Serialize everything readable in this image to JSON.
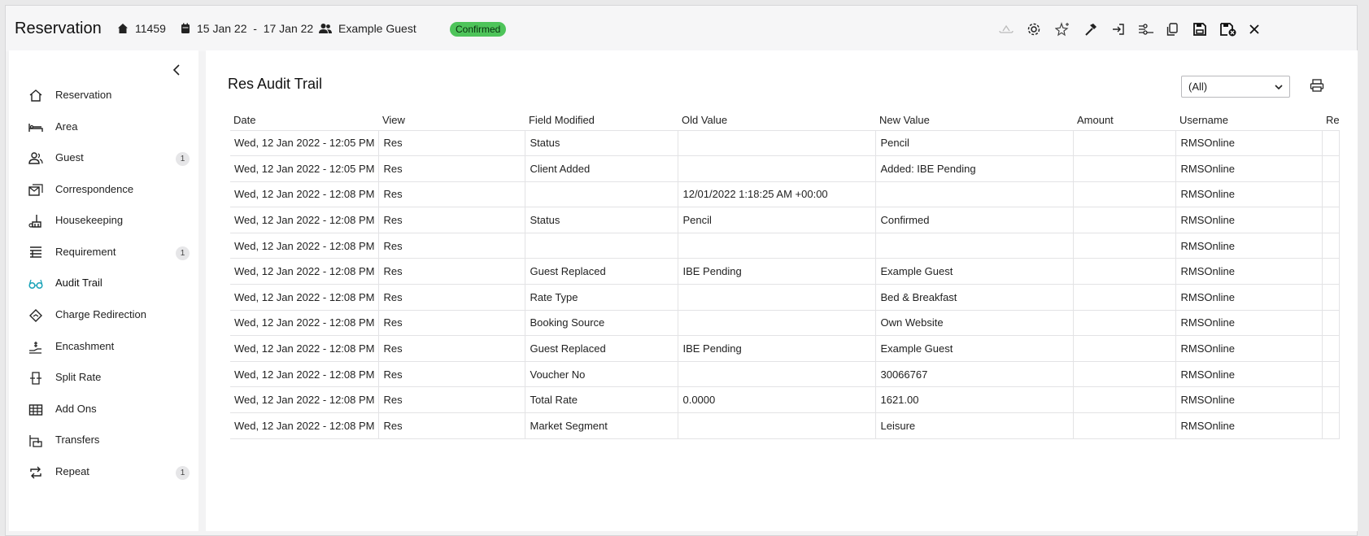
{
  "header": {
    "title": "Reservation",
    "property_id": "11459",
    "dates": "15 Jan 22  -  17 Jan 22",
    "guest": "Example Guest",
    "status": "Confirmed",
    "status_color": "#4ec45a"
  },
  "sidebar": {
    "items": [
      {
        "label": "Reservation",
        "icon": "home-icon"
      },
      {
        "label": "Area",
        "icon": "bed-icon"
      },
      {
        "label": "Guest",
        "icon": "users-icon",
        "count": "1"
      },
      {
        "label": "Correspondence",
        "icon": "mail-icon"
      },
      {
        "label": "Housekeeping",
        "icon": "housekeeping-icon"
      },
      {
        "label": "Requirement",
        "icon": "list-icon",
        "count": "1"
      },
      {
        "label": "Audit Trail",
        "icon": "glasses-icon"
      },
      {
        "label": "Charge Redirection",
        "icon": "redirect-icon"
      },
      {
        "label": "Encashment",
        "icon": "encash-icon"
      },
      {
        "label": "Split Rate",
        "icon": "split-icon"
      },
      {
        "label": "Add Ons",
        "icon": "grid-icon"
      },
      {
        "label": "Transfers",
        "icon": "transfer-icon"
      },
      {
        "label": "Repeat",
        "icon": "repeat-icon",
        "count": "1"
      }
    ],
    "active": "Audit Trail",
    "accent_color": "#1aa3b8"
  },
  "main": {
    "title": "Res Audit Trail",
    "filter": "(All)",
    "columns": [
      "Date",
      "View",
      "Field Modified",
      "Old Value",
      "New Value",
      "Amount",
      "Username",
      "Re"
    ],
    "rows": [
      [
        "Wed, 12 Jan 2022 - 12:05 PM",
        "Res",
        "Status",
        "",
        "Pencil",
        "",
        "RMSOnline",
        ""
      ],
      [
        "Wed, 12 Jan 2022 - 12:05 PM",
        "Res",
        "Client Added",
        "",
        "Added: IBE Pending",
        "",
        "RMSOnline",
        ""
      ],
      [
        "Wed, 12 Jan 2022 - 12:08 PM",
        "Res",
        "",
        "12/01/2022 1:18:25 AM +00:00",
        "",
        "",
        "RMSOnline",
        ""
      ],
      [
        "Wed, 12 Jan 2022 - 12:08 PM",
        "Res",
        "Status",
        "Pencil",
        "Confirmed",
        "",
        "RMSOnline",
        ""
      ],
      [
        "Wed, 12 Jan 2022 - 12:08 PM",
        "Res",
        "",
        "",
        "",
        "",
        "RMSOnline",
        ""
      ],
      [
        "Wed, 12 Jan 2022 - 12:08 PM",
        "Res",
        "Guest Replaced",
        "IBE Pending",
        "Example Guest",
        "",
        "RMSOnline",
        ""
      ],
      [
        "Wed, 12 Jan 2022 - 12:08 PM",
        "Res",
        "Rate Type",
        "",
        "Bed & Breakfast",
        "",
        "RMSOnline",
        ""
      ],
      [
        "Wed, 12 Jan 2022 - 12:08 PM",
        "Res",
        "Booking Source",
        "",
        "Own Website",
        "",
        "RMSOnline",
        ""
      ],
      [
        "Wed, 12 Jan 2022 - 12:08 PM",
        "Res",
        "Guest Replaced",
        "IBE Pending",
        "Example Guest",
        "",
        "RMSOnline",
        ""
      ],
      [
        "Wed, 12 Jan 2022 - 12:08 PM",
        "Res",
        "Voucher No",
        "",
        "30066767",
        "",
        "RMSOnline",
        ""
      ],
      [
        "Wed, 12 Jan 2022 - 12:08 PM",
        "Res",
        "Total Rate",
        "0.0000",
        "1621.00",
        "",
        "RMSOnline",
        ""
      ],
      [
        "Wed, 12 Jan 2022 - 12:08 PM",
        "Res",
        "Market Segment",
        "",
        "Leisure",
        "",
        "RMSOnline",
        ""
      ]
    ]
  },
  "toolbar": {
    "icons": [
      "cloud-icon",
      "gear-icon",
      "sparkle-icon",
      "hammer-icon",
      "sign-in-icon",
      "sliders-icon",
      "copy-icon",
      "save-icon",
      "save-close-icon",
      "close-icon"
    ]
  }
}
